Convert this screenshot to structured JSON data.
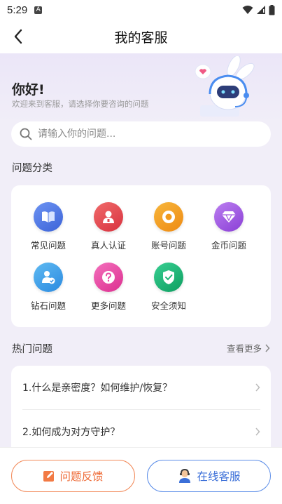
{
  "status_bar": {
    "time": "5:29",
    "notif_letter": "A"
  },
  "header": {
    "title": "我的客服"
  },
  "greeting": {
    "hello": "你好!",
    "subtitle": "欢迎来到客服，请选择你要咨询的问题"
  },
  "search": {
    "placeholder": "请输入你的问题..."
  },
  "categories": {
    "title": "问题分类",
    "items": [
      {
        "label": "常见问题",
        "icon": "book-icon",
        "color": "#4d79e6"
      },
      {
        "label": "真人认证",
        "icon": "person-icon",
        "color": "#e8454f"
      },
      {
        "label": "账号问题",
        "icon": "account-icon",
        "color": "#f29a1d"
      },
      {
        "label": "金币问题",
        "icon": "diamond-icon",
        "color": "#a25be0"
      },
      {
        "label": "钻石问题",
        "icon": "user-check-icon",
        "color": "#3aa0e8"
      },
      {
        "label": "更多问题",
        "icon": "question-icon",
        "color": "#e94aa6"
      },
      {
        "label": "安全须知",
        "icon": "shield-check-icon",
        "color": "#1eb676"
      }
    ]
  },
  "hot": {
    "title": "热门问题",
    "more": "查看更多",
    "items": [
      {
        "text": "1.什么是亲密度？如何维护/恢复？"
      },
      {
        "text": "2.如何成为对方守护？"
      }
    ]
  },
  "bottom": {
    "feedback_label": "问题反馈",
    "service_label": "在线客服"
  }
}
